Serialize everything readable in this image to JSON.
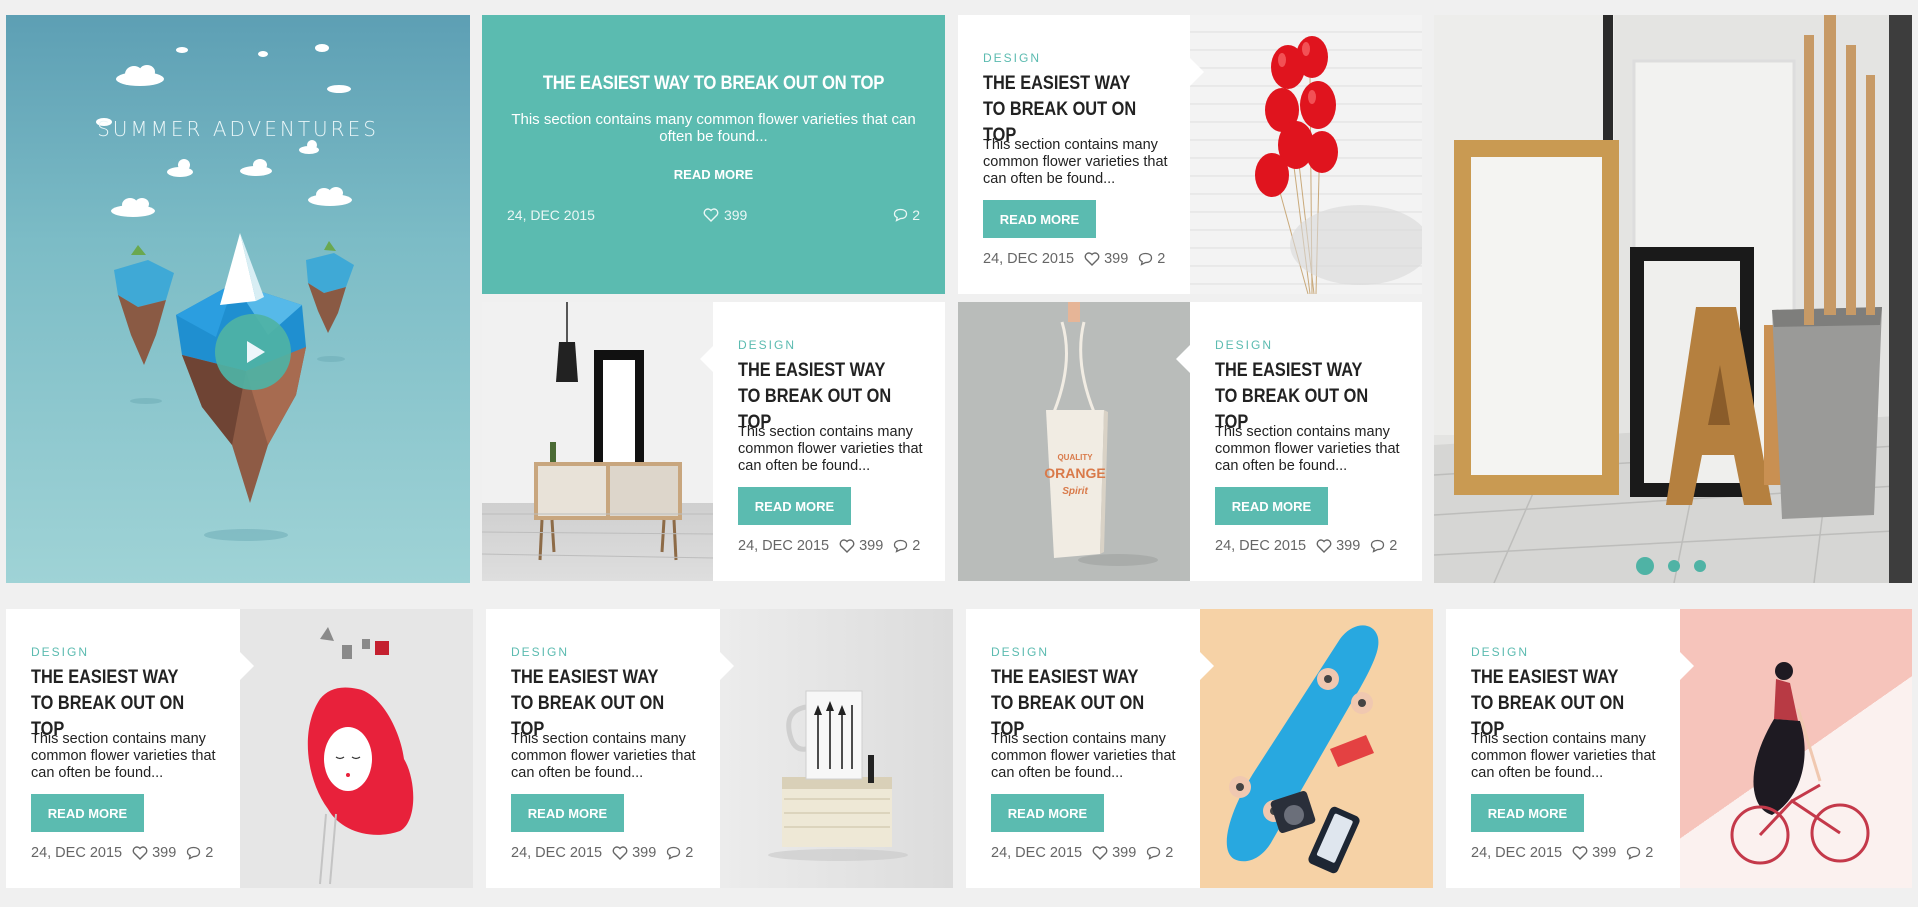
{
  "hero": {
    "title": "SUMMER ADVENTURES",
    "play_label": "play-video"
  },
  "feature": {
    "title": "THE EASIEST WAY TO BREAK OUT ON TOP",
    "excerpt": "This section contains many common flower varieties that can often be found...",
    "read_more": "READ MORE",
    "date": "24, DEC 2015",
    "likes": "399",
    "comments": "2"
  },
  "cards": [
    {
      "category": "DESIGN",
      "title": "THE EASIEST WAY TO BREAK OUT ON TOP",
      "excerpt": "This section contains many common flower varieties that can often be found...",
      "button": "READ MORE",
      "date": "24, DEC 2015",
      "likes": "399",
      "comments": "2",
      "image": "red-balloons"
    },
    {
      "category": "DESIGN",
      "title": "THE EASIEST WAY TO BREAK OUT ON TOP",
      "excerpt": "This section contains many common flower varieties that can often be found...",
      "button": "READ MORE",
      "date": "24, DEC 2015",
      "likes": "399",
      "comments": "2",
      "image": "mirror-cabinet"
    },
    {
      "category": "DESIGN",
      "title": "THE EASIEST WAY TO BREAK OUT ON TOP",
      "excerpt": "This section contains many common flower varieties that can often be found...",
      "button": "READ MORE",
      "date": "24, DEC 2015",
      "likes": "399",
      "comments": "2",
      "image": "tote-bag"
    },
    {
      "category": "DESIGN",
      "title": "THE EASIEST WAY TO BREAK OUT ON TOP",
      "excerpt": "This section contains many common flower varieties that can often be found...",
      "button": "READ MORE",
      "date": "24, DEC 2015",
      "likes": "399",
      "comments": "2",
      "image": "red-hair-illustration"
    },
    {
      "category": "DESIGN",
      "title": "THE EASIEST WAY TO BREAK OUT ON TOP",
      "excerpt": "This section contains many common flower varieties that can often be found...",
      "button": "READ MORE",
      "date": "24, DEC 2015",
      "likes": "399",
      "comments": "2",
      "image": "mug-on-book"
    },
    {
      "category": "DESIGN",
      "title": "THE EASIEST WAY TO BREAK OUT ON TOP",
      "excerpt": "This section contains many common flower varieties that can often be found...",
      "button": "READ MORE",
      "date": "24, DEC 2015",
      "likes": "399",
      "comments": "2",
      "image": "skateboard"
    },
    {
      "category": "DESIGN",
      "title": "THE EASIEST WAY TO BREAK OUT ON TOP",
      "excerpt": "This section contains many common flower varieties that can often be found...",
      "button": "READ MORE",
      "date": "24, DEC 2015",
      "likes": "399",
      "comments": "2",
      "image": "girl-on-bicycle"
    }
  ],
  "slider": {
    "image": "frames-and-letters",
    "slide_count": 3,
    "active_slide": 1
  },
  "colors": {
    "accent": "#5bbbb0",
    "background": "#f0f0f0",
    "text": "#222222",
    "meta": "#666666"
  },
  "icons": {
    "likes": "heart-icon",
    "comments": "comment-icon"
  }
}
